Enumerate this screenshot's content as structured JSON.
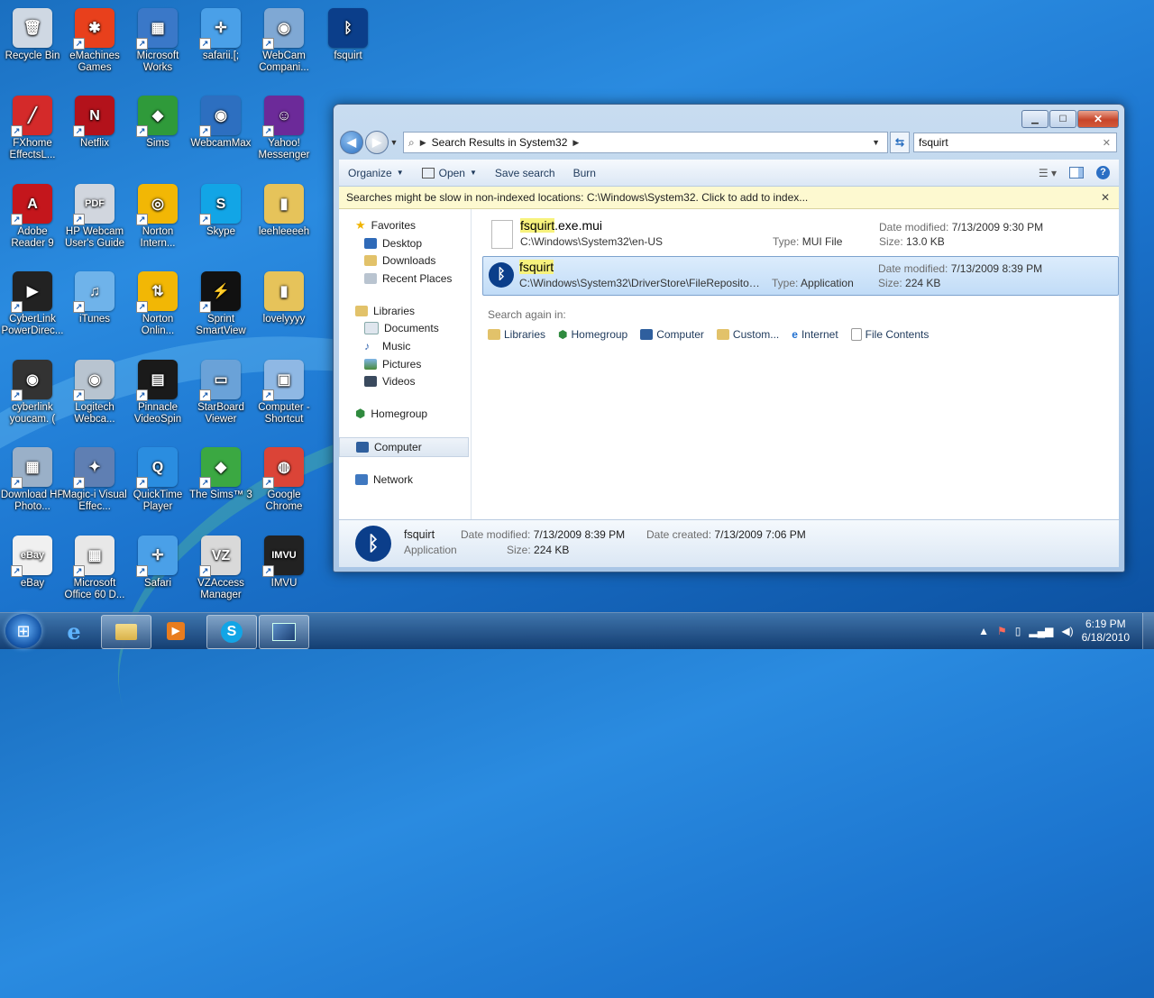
{
  "desktop": {
    "icons": [
      {
        "label": "Recycle Bin",
        "icon": "recycle-bin-icon",
        "color": "#cfd8e3",
        "glyph": "🗑"
      },
      {
        "label": "eMachines Games",
        "icon": "emachines-games-icon",
        "color": "#e8401c",
        "glyph": "✱"
      },
      {
        "label": "Microsoft Works",
        "icon": "microsoft-works-icon",
        "color": "#3a78c8",
        "glyph": "▦"
      },
      {
        "label": "safarii.[;",
        "icon": "safari-icon",
        "color": "#4aa0e8",
        "glyph": "✛"
      },
      {
        "label": "WebCam Compani...",
        "icon": "webcam-icon",
        "color": "#7fa8d4",
        "glyph": "◉"
      },
      {
        "label": "fsquirt",
        "icon": "bluetooth-icon",
        "color": "#0b3e8a",
        "glyph": "ᛒ"
      },
      {
        "label": "FXhome EffectsL...",
        "icon": "fxhome-icon",
        "color": "#d42a2a",
        "glyph": "╱"
      },
      {
        "label": "Netflix",
        "icon": "netflix-icon",
        "color": "#b3121b",
        "glyph": "N"
      },
      {
        "label": "Sims",
        "icon": "sims-icon",
        "color": "#2f9a3a",
        "glyph": "◆"
      },
      {
        "label": "WebcamMax",
        "icon": "webcammax-icon",
        "color": "#2d6fc0",
        "glyph": "◉"
      },
      {
        "label": "Yahoo! Messenger",
        "icon": "yahoo-messenger-icon",
        "color": "#6c2a99",
        "glyph": "☺"
      },
      {
        "label": "Adobe Reader 9",
        "icon": "adobe-reader-icon",
        "color": "#c4161c",
        "glyph": "A"
      },
      {
        "label": "HP Webcam User's Guide",
        "icon": "pdf-document-icon",
        "color": "#d1d6de",
        "glyph": "PDF"
      },
      {
        "label": "Norton Intern...",
        "icon": "norton-internet-icon",
        "color": "#f2b705",
        "glyph": "◎"
      },
      {
        "label": "Skype",
        "icon": "skype-icon",
        "color": "#12a5e6",
        "glyph": "S"
      },
      {
        "label": "leehleeeeh",
        "icon": "folder-icon",
        "color": "#e6c35a",
        "glyph": "▮"
      },
      {
        "label": "CyberLink PowerDirec...",
        "icon": "powerdirector-icon",
        "color": "#222222",
        "glyph": "▶"
      },
      {
        "label": "iTunes",
        "icon": "itunes-icon",
        "color": "#6fb3ea",
        "glyph": "♫"
      },
      {
        "label": "Norton Onlin...",
        "icon": "norton-online-icon",
        "color": "#f2b705",
        "glyph": "⇅"
      },
      {
        "label": "Sprint SmartView",
        "icon": "sprint-icon",
        "color": "#111111",
        "glyph": "⚡"
      },
      {
        "label": "lovelyyyy",
        "icon": "folder-icon",
        "color": "#e6c35a",
        "glyph": "▮"
      },
      {
        "label": "cyberlink youcam. (",
        "icon": "youcam-icon",
        "color": "#333333",
        "glyph": "◉"
      },
      {
        "label": "Logitech Webca...",
        "icon": "logitech-webcam-icon",
        "color": "#b8c4d0",
        "glyph": "◉"
      },
      {
        "label": "Pinnacle VideoSpin",
        "icon": "pinnacle-icon",
        "color": "#1a1a1a",
        "glyph": "▤"
      },
      {
        "label": "StarBoard Viewer",
        "icon": "starboard-icon",
        "color": "#6aa2d8",
        "glyph": "▭"
      },
      {
        "label": "Computer - Shortcut",
        "icon": "computer-icon",
        "color": "#8fb8e4",
        "glyph": "▣"
      },
      {
        "label": "Download HP Photo...",
        "icon": "hp-photo-icon",
        "color": "#9ab0c8",
        "glyph": "▦"
      },
      {
        "label": "Magic-i Visual Effec...",
        "icon": "magic-i-icon",
        "color": "#5f7fb3",
        "glyph": "✦"
      },
      {
        "label": "QuickTime Player",
        "icon": "quicktime-icon",
        "color": "#2a8de0",
        "glyph": "Q"
      },
      {
        "label": "The Sims™ 3",
        "icon": "sims3-icon",
        "color": "#3ba842",
        "glyph": "◆"
      },
      {
        "label": "Google Chrome",
        "icon": "chrome-icon",
        "color": "#db4437",
        "glyph": "◍"
      },
      {
        "label": "eBay",
        "icon": "ebay-icon",
        "color": "#f0f0f0",
        "glyph": "eBay"
      },
      {
        "label": "Microsoft Office 60 D...",
        "icon": "office-trial-icon",
        "color": "#e8e8e8",
        "glyph": "▦"
      },
      {
        "label": "Safari",
        "icon": "safari-icon",
        "color": "#4aa0e8",
        "glyph": "✛"
      },
      {
        "label": "VZAccess Manager",
        "icon": "vzaccess-icon",
        "color": "#d9d9d9",
        "glyph": "VZ"
      },
      {
        "label": "IMVU",
        "icon": "imvu-icon",
        "color": "#222222",
        "glyph": "IMVU"
      }
    ]
  },
  "window": {
    "address": {
      "breadcrumb": "Search Results in System32"
    },
    "search": {
      "value": "fsquirt"
    },
    "toolbar": {
      "organize": "Organize",
      "open": "Open",
      "save_search": "Save search",
      "burn": "Burn"
    },
    "infobar": {
      "text": "Searches might be slow in non-indexed locations: C:\\Windows\\System32. Click to add to index..."
    },
    "navpane": {
      "favorites": {
        "label": "Favorites",
        "items": [
          "Desktop",
          "Downloads",
          "Recent Places"
        ]
      },
      "libraries": {
        "label": "Libraries",
        "items": [
          "Documents",
          "Music",
          "Pictures",
          "Videos"
        ]
      },
      "homegroup": "Homegroup",
      "computer": "Computer",
      "network": "Network"
    },
    "results": [
      {
        "name_hl": "fsquirt",
        "name_rest": ".exe.mui",
        "path": "C:\\Windows\\System32\\en-US",
        "type_label": "Type:",
        "type": "MUI File",
        "date_label": "Date modified:",
        "date": "7/13/2009 9:30 PM",
        "size_label": "Size:",
        "size": "13.0 KB"
      },
      {
        "name_hl": "fsquirt",
        "name_rest": "",
        "path": "C:\\Windows\\System32\\DriverStore\\FileRepository\\b...",
        "type_label": "Type:",
        "type": "Application",
        "date_label": "Date modified:",
        "date": "7/13/2009 8:39 PM",
        "size_label": "Size:",
        "size": "224 KB"
      }
    ],
    "search_again": {
      "label": "Search again in:",
      "items": [
        "Libraries",
        "Homegroup",
        "Computer",
        "Custom...",
        "Internet",
        "File Contents"
      ]
    },
    "details": {
      "name": "fsquirt",
      "kind": "Application",
      "date_modified_label": "Date modified:",
      "date_modified": "7/13/2009 8:39 PM",
      "date_created_label": "Date created:",
      "date_created": "7/13/2009 7:06 PM",
      "size_label": "Size:",
      "size": "224 KB"
    }
  },
  "taskbar": {
    "clock_time": "6:19 PM",
    "clock_date": "6/18/2010"
  }
}
